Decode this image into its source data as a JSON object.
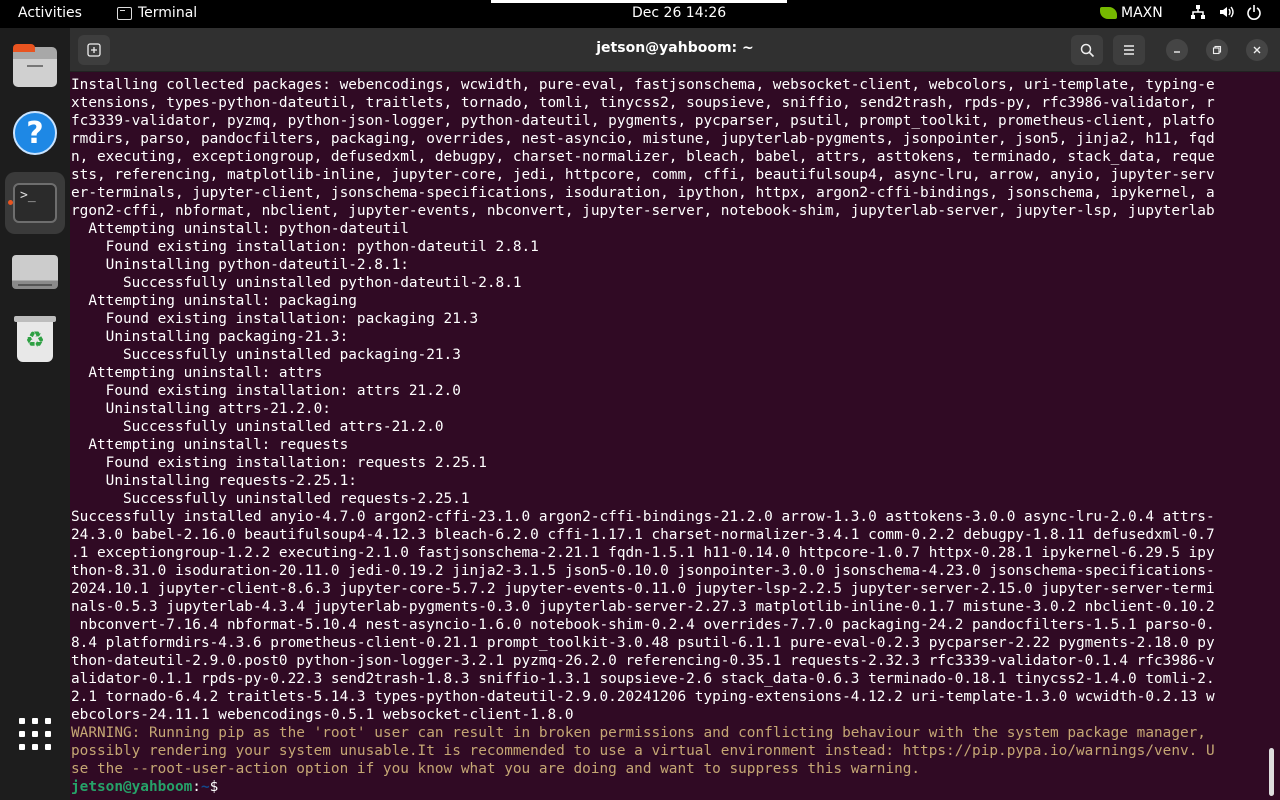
{
  "topbar": {
    "activities": "Activities",
    "app_name": "Terminal",
    "clock": "Dec 26  14:26",
    "power_mode": "MAXN"
  },
  "dock": {
    "items": [
      "files-icon",
      "help-icon",
      "terminal-icon",
      "drive-icon",
      "trash-icon",
      "show-apps-icon"
    ]
  },
  "window": {
    "title": "jetson@yahboom: ~"
  },
  "terminal": {
    "lines": [
      "Installing collected packages: webencodings, wcwidth, pure-eval, fastjsonschema, websocket-client, webcolors, uri-template, typing-e",
      "xtensions, types-python-dateutil, traitlets, tornado, tomli, tinycss2, soupsieve, sniffio, send2trash, rpds-py, rfc3986-validator, r",
      "fc3339-validator, pyzmq, python-json-logger, python-dateutil, pygments, pycparser, psutil, prompt_toolkit, prometheus-client, platfo",
      "rmdirs, parso, pandocfilters, packaging, overrides, nest-asyncio, mistune, jupyterlab-pygments, jsonpointer, json5, jinja2, h11, fqd",
      "n, executing, exceptiongroup, defusedxml, debugpy, charset-normalizer, bleach, babel, attrs, asttokens, terminado, stack_data, reque",
      "sts, referencing, matplotlib-inline, jupyter-core, jedi, httpcore, comm, cffi, beautifulsoup4, async-lru, arrow, anyio, jupyter-serv",
      "er-terminals, jupyter-client, jsonschema-specifications, isoduration, ipython, httpx, argon2-cffi-bindings, jsonschema, ipykernel, a",
      "rgon2-cffi, nbformat, nbclient, jupyter-events, nbconvert, jupyter-server, notebook-shim, jupyterlab-server, jupyter-lsp, jupyterlab",
      "  Attempting uninstall: python-dateutil",
      "    Found existing installation: python-dateutil 2.8.1",
      "    Uninstalling python-dateutil-2.8.1:",
      "      Successfully uninstalled python-dateutil-2.8.1",
      "  Attempting uninstall: packaging",
      "    Found existing installation: packaging 21.3",
      "    Uninstalling packaging-21.3:",
      "      Successfully uninstalled packaging-21.3",
      "  Attempting uninstall: attrs",
      "    Found existing installation: attrs 21.2.0",
      "    Uninstalling attrs-21.2.0:",
      "      Successfully uninstalled attrs-21.2.0",
      "  Attempting uninstall: requests",
      "    Found existing installation: requests 2.25.1",
      "    Uninstalling requests-2.25.1:",
      "      Successfully uninstalled requests-2.25.1",
      "Successfully installed anyio-4.7.0 argon2-cffi-23.1.0 argon2-cffi-bindings-21.2.0 arrow-1.3.0 asttokens-3.0.0 async-lru-2.0.4 attrs-",
      "24.3.0 babel-2.16.0 beautifulsoup4-4.12.3 bleach-6.2.0 cffi-1.17.1 charset-normalizer-3.4.1 comm-0.2.2 debugpy-1.8.11 defusedxml-0.7",
      ".1 exceptiongroup-1.2.2 executing-2.1.0 fastjsonschema-2.21.1 fqdn-1.5.1 h11-0.14.0 httpcore-1.0.7 httpx-0.28.1 ipykernel-6.29.5 ipy",
      "thon-8.31.0 isoduration-20.11.0 jedi-0.19.2 jinja2-3.1.5 json5-0.10.0 jsonpointer-3.0.0 jsonschema-4.23.0 jsonschema-specifications-",
      "2024.10.1 jupyter-client-8.6.3 jupyter-core-5.7.2 jupyter-events-0.11.0 jupyter-lsp-2.2.5 jupyter-server-2.15.0 jupyter-server-termi",
      "nals-0.5.3 jupyterlab-4.3.4 jupyterlab-pygments-0.3.0 jupyterlab-server-2.27.3 matplotlib-inline-0.1.7 mistune-3.0.2 nbclient-0.10.2",
      " nbconvert-7.16.4 nbformat-5.10.4 nest-asyncio-1.6.0 notebook-shim-0.2.4 overrides-7.7.0 packaging-24.2 pandocfilters-1.5.1 parso-0.",
      "8.4 platformdirs-4.3.6 prometheus-client-0.21.1 prompt_toolkit-3.0.48 psutil-6.1.1 pure-eval-0.2.3 pycparser-2.22 pygments-2.18.0 py",
      "thon-dateutil-2.9.0.post0 python-json-logger-3.2.1 pyzmq-26.2.0 referencing-0.35.1 requests-2.32.3 rfc3339-validator-0.1.4 rfc3986-v",
      "alidator-0.1.1 rpds-py-0.22.3 send2trash-1.8.3 sniffio-1.3.1 soupsieve-2.6 stack_data-0.6.3 terminado-0.18.1 tinycss2-1.4.0 tomli-2.",
      "2.1 tornado-6.4.2 traitlets-5.14.3 types-python-dateutil-2.9.0.20241206 typing-extensions-4.12.2 uri-template-1.3.0 wcwidth-0.2.13 w",
      "ebcolors-24.11.1 webencodings-0.5.1 websocket-client-1.8.0"
    ],
    "warning_lines": [
      "WARNING: Running pip as the 'root' user can result in broken permissions and conflicting behaviour with the system package manager,",
      "possibly rendering your system unusable.It is recommended to use a virtual environment instead: https://pip.pypa.io/warnings/venv. U",
      "se the --root-user-action option if you know what you are doing and want to suppress this warning."
    ],
    "prompt": {
      "user": "jetson@yahboom",
      "sep": ":",
      "path": "~",
      "symbol": "$"
    }
  },
  "colors": {
    "terminal_bg": "#300a24",
    "prompt_user": "#26a269",
    "prompt_path": "#12488b",
    "warning": "#c5a774",
    "accent": "#e95420"
  }
}
